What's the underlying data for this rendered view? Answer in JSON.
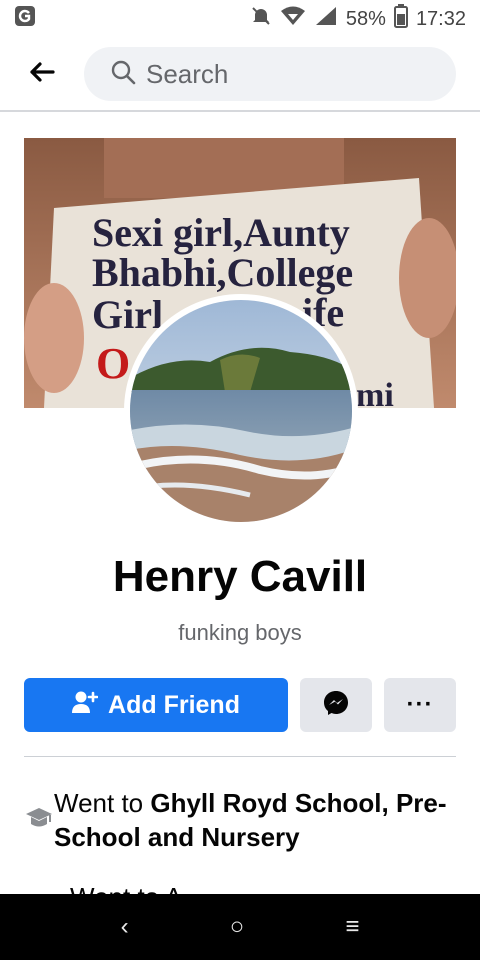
{
  "status_bar": {
    "battery": "58%",
    "time": "17:32",
    "icons": [
      "app-icon",
      "mute-icon",
      "wifi-icon",
      "signal-icon",
      "battery-icon"
    ]
  },
  "header": {
    "search_placeholder": "Search",
    "back_icon": "back-arrow-icon"
  },
  "cover_text": {
    "line1": "Sexi girl,Aunty",
    "line2": "Bhabhi,College",
    "line3": "Girl",
    "line3b": "ife",
    "line4": "O",
    "line4b": "mi"
  },
  "profile": {
    "name": "Henry Cavill",
    "bio": "funking boys"
  },
  "actions": {
    "add_friend_label": "Add Friend",
    "more_label": "···"
  },
  "about": {
    "education_prefix": "Went to ",
    "education_school": "Ghyll Royd School, Pre-School and Nursery",
    "second_row_partial": "Went to A"
  },
  "nav": {
    "back": "‹",
    "home": "○",
    "recent": "≡"
  },
  "colors": {
    "primary_blue": "#1877f2",
    "button_grey": "#e4e6eb",
    "search_bg": "#f0f2f5",
    "secondary_text": "#65676b"
  }
}
